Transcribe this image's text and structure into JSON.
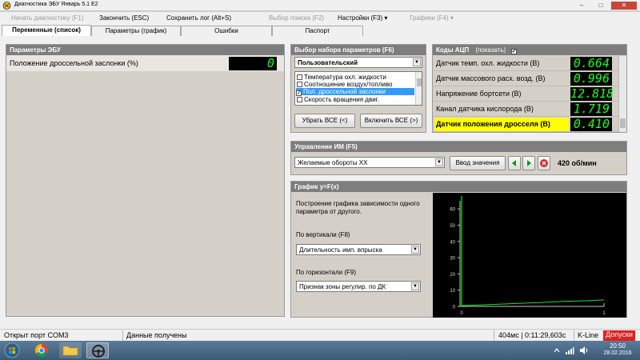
{
  "window": {
    "title": "Диагностика ЭБУ Январь 5.1 Е2",
    "min": "–",
    "max": "□",
    "close": "✕"
  },
  "menu": [
    {
      "label": "Начать диагностику (F1)",
      "enabled": false
    },
    {
      "label": "Закончить (ESC)",
      "enabled": true
    },
    {
      "label": "Сохранить лог (Alt+S)",
      "enabled": true
    },
    {
      "label": "Выбор поиска (F2)",
      "enabled": false
    },
    {
      "label": "Настройки (F3) ▾",
      "enabled": true
    },
    {
      "label": "Графики (F4) ▾",
      "enabled": false
    }
  ],
  "tabs": [
    "Переменные (список)",
    "Параметры (график)",
    "Ошибки",
    "Паспорт"
  ],
  "ecu_panel": {
    "title": "Параметры ЭБУ",
    "param_label": "Положение дроссельной заслонки (%)",
    "param_value": "0"
  },
  "param_select": {
    "title": "Выбор набора параметров (F6)",
    "preset": "Пользовательский",
    "items": [
      {
        "label": "Температура охл. жидкости",
        "checked": false,
        "selected": false
      },
      {
        "label": "Соотношение воздух/топливо",
        "checked": false,
        "selected": false
      },
      {
        "label": "Пол. дроссельной заслонки",
        "checked": true,
        "selected": true
      },
      {
        "label": "Скорость вращения двиг.",
        "checked": false,
        "selected": false
      }
    ],
    "remove_all": "Убрать ВСЕ (<)",
    "include_all": "Включить ВСЕ (>)"
  },
  "adc": {
    "title": "Коды АЦП",
    "show_label": "(показать)",
    "show_checked": true,
    "rows": [
      {
        "label": "Датчик темп. охл. жидкости (В)",
        "value": "0.664",
        "highlight": false
      },
      {
        "label": "Датчик массового расх. возд. (В)",
        "value": "0.996",
        "highlight": false
      },
      {
        "label": "Напряжение бортсети (В)",
        "value": "12.818",
        "highlight": false
      },
      {
        "label": "Канал датчика кислорода (В)",
        "value": "1.719",
        "highlight": false
      },
      {
        "label": "Датчик положения дросселя (В)",
        "value": "0.410",
        "highlight": true
      }
    ]
  },
  "control": {
    "title": "Управление ИМ (F5)",
    "selected": "Желаемые обороты ХХ",
    "input_button": "Ввод значения",
    "rpm": "420 об/мин"
  },
  "graph": {
    "title": "График y=F(x)",
    "description": "Построение графика зависимости одного параметра от другого.",
    "vertical_label": "По вертикали (F8)",
    "vertical_value": "Длительность имп. впрыска",
    "horizontal_label": "По горизонтали (F9)",
    "horizontal_value": "Признак зоны регулир. по ДК",
    "plot_bg": "#000000",
    "line_color": "#19e619",
    "axis_color": "#c8c8c8"
  },
  "chart_data": {
    "type": "line",
    "y_ticks": [
      "60",
      "50",
      "40",
      "30",
      "20",
      "10",
      "0"
    ],
    "x_ticks": [
      "0",
      "1"
    ],
    "ylim": [
      0,
      65
    ],
    "xlim": [
      0,
      1
    ],
    "x": [
      0,
      0.1,
      0.3,
      0.5,
      0.7,
      0.9,
      1.0
    ],
    "y": [
      0.5,
      0.8,
      1.5,
      2.2,
      3.0,
      3.6,
      4.0
    ],
    "vline_x": 0
  },
  "status": {
    "port": "Открыт порт COM3",
    "data": "Данные получены",
    "timing": "404мс | 0:11:29,603c",
    "kline": "K-Line",
    "permit": "Допуски"
  },
  "taskbar": {
    "time": "20:50",
    "date": "28.02.2016"
  }
}
